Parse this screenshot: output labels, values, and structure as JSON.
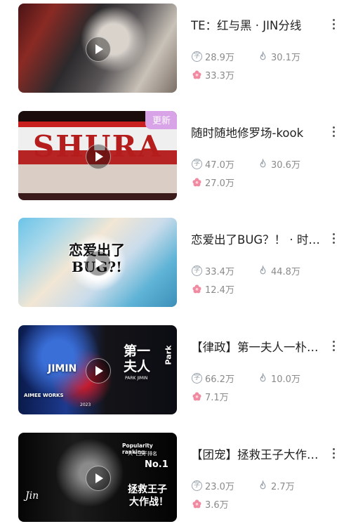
{
  "colors": {
    "badge_bg": "#d9a3e8",
    "title_text": "#222222",
    "stat_text": "#8a8a8a",
    "flower_icon": "#f08aa0",
    "icon_gray": "#9aa3ad"
  },
  "icons": {
    "words": "words-count-icon",
    "fire": "popularity-flame-icon",
    "flower": "flower-icon",
    "play": "play-icon",
    "menu": "more-vertical-icon"
  },
  "items": [
    {
      "title": "TE：红与黑 · JIN分线",
      "words": "28.9万",
      "heat": "30.1万",
      "flowers": "33.3万",
      "badge": "",
      "overlay": []
    },
    {
      "title": "随时随地修罗场-kook",
      "words": "47.0万",
      "heat": "30.6万",
      "flowers": "27.0万",
      "badge": "更新",
      "overlay": [
        "SHURA"
      ]
    },
    {
      "title": "恋爱出了BUG？！ · 时间线",
      "words": "33.4万",
      "heat": "44.8万",
      "flowers": "12.4万",
      "badge": "",
      "overlay": [
        "恋爱出了BUG?!"
      ]
    },
    {
      "title": "【律政】第一夫人一朴智旻",
      "words": "66.2万",
      "heat": "10.0万",
      "flowers": "7.1万",
      "badge": "",
      "overlay": [
        "JIMIN",
        "第一夫人",
        "Park",
        "PARK JIMIN",
        "AIMEE WORKS",
        "2023"
      ]
    },
    {
      "title": "【团宠】拯救王子大作战！",
      "words": "23.0万",
      "heat": "2.7万",
      "flowers": "3.6万",
      "badge": "",
      "overlay": [
        "Popularity ranking",
        "人气王子排名",
        "No.1",
        "拯救王子",
        "大作战！",
        "Jin"
      ]
    }
  ]
}
